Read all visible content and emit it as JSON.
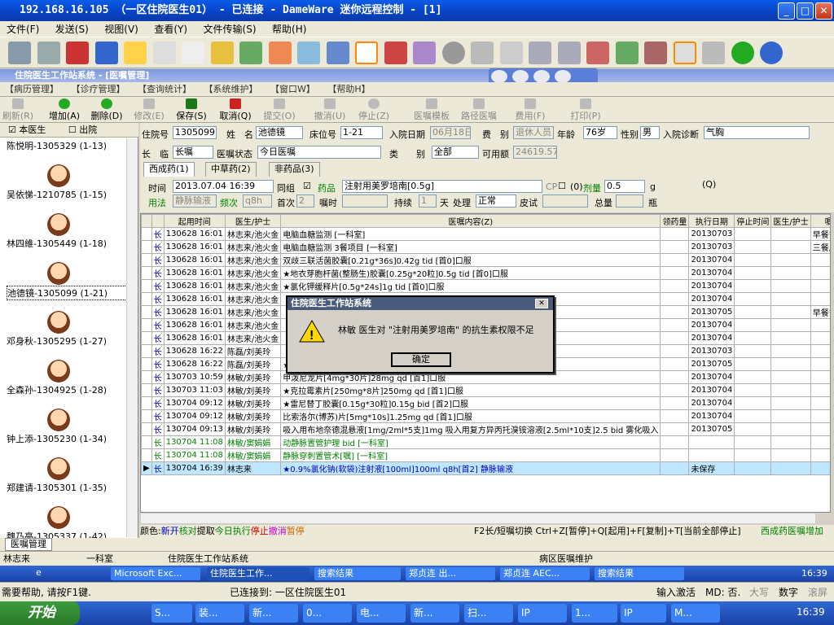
{
  "window": {
    "title": "192.168.16.105 （一区住院医生01） - 已连接 - DameWare 迷你远程控制 - [1]"
  },
  "remote_menu": [
    "文件(F)",
    "发送(S)",
    "视图(V)",
    "查看(Y)",
    "文件传输(S)",
    "帮助(H)"
  ],
  "app": {
    "title": "住院医生工作站系统 - [医嘱管理]",
    "menu": [
      "【病历管理】",
      "【诊疗管理】",
      "【查询统计】",
      "【系统维护】",
      "【窗口W】",
      "【帮助H】"
    ],
    "toolbar": [
      {
        "label": "刷新(R)",
        "enabled": false
      },
      {
        "label": "增加(A)",
        "enabled": true
      },
      {
        "label": "删除(D)",
        "enabled": true
      },
      {
        "label": "修改(E)",
        "enabled": false
      },
      {
        "label": "保存(S)",
        "enabled": true
      },
      {
        "label": "取消(Q)",
        "enabled": true
      },
      {
        "label": "提交(O)",
        "enabled": false
      },
      {
        "label": "撤消(U)",
        "enabled": false
      },
      {
        "label": "停止(Z)",
        "enabled": false
      },
      {
        "label": "医嘱模板",
        "enabled": false
      },
      {
        "label": "路径医嘱",
        "enabled": false
      },
      {
        "label": "费用(F)",
        "enabled": false
      },
      {
        "label": "打印(P)",
        "enabled": false
      }
    ]
  },
  "patients_panel": {
    "this_doctor_label": "本医生",
    "discharged_label": "出院",
    "patients": [
      "陈悦明-1305329 (1-13)",
      "吴依悌-1210785 (1-15)",
      "林四維-1305449 (1-18)",
      "池德镜-1305099 (1-21)",
      "邓身秋-1305295 (1-27)",
      "全森孙-1304925 (1-28)",
      "钟上添-1305230 (1-34)",
      "郑建请-1305301 (1-35)",
      "魏乃亮-1305337 (1-42)"
    ]
  },
  "form": {
    "admission_no_label": "住院号",
    "admission_no": "1305099",
    "name_label": "姓　名",
    "name": "池德镜",
    "bed_label": "床位号",
    "bed": "1-21",
    "admit_date_label": "入院日期",
    "admit_date": "06月18日",
    "fee_label": "费　别",
    "fee": "退休人员",
    "age_label": "年龄",
    "age": "76岁",
    "sex_label": "性别",
    "sex": "男",
    "diag_label": "入院诊断",
    "diag": "气胸",
    "order_type_label": "长　临",
    "order_type": "长嘱",
    "status_label": "医嘱状态",
    "status": "今日医嘱",
    "category_label": "类　　别",
    "category": "全部",
    "balance_label": "可用额",
    "balance": "24619.57",
    "tabs": [
      "西成药(1)",
      "中草药(2)",
      "非药品(3)"
    ],
    "time_label": "时间",
    "time": "2013.07.04 16:39",
    "group_label": "同组",
    "drug_label": "药品",
    "drug": "注射用美罗培南[0.5g]",
    "cp_label": "CP",
    "o_label": "(0)",
    "dose_label": "剂量",
    "dose": "0.5",
    "dose_unit": "g",
    "q_label": "(Q)",
    "usage_label": "用法",
    "usage": "静脉输液",
    "freq_label": "频次",
    "freq": "q8h",
    "first_label": "首次",
    "first": "2",
    "sleep_label": "嘱时",
    "duration_label": "持续",
    "duration": "1",
    "days_label": "天",
    "process_label": "处理",
    "process": "正常",
    "skin_label": "皮试",
    "total_label": "总量",
    "total_unit": "瓶"
  },
  "grid": {
    "headers": [
      "",
      "起用时间",
      "医生/护士",
      "医嘱内容(Z)",
      "领药量",
      "执行日期",
      "停止时间",
      "医生/护士",
      "嘱咐"
    ],
    "rows": [
      [
        "长",
        "130628 16:01",
        "林志来/池火金",
        "电脑血糖监测 [一科室]",
        "",
        "20130703",
        "",
        "",
        "早餐前"
      ],
      [
        "长",
        "130628 16:01",
        "林志来/池火金",
        "电脑血糖监测 3餐项目 [一科室]",
        "",
        "20130703",
        "",
        "",
        "三餐后2h"
      ],
      [
        "长",
        "130628 16:01",
        "林志来/池火金",
        "双歧三联活菌胶囊[0.21g*36s]0.42g tid [首0]口服",
        "",
        "20130704",
        "",
        "",
        ""
      ],
      [
        "长",
        "130628 16:01",
        "林志来/池火金",
        "★地衣芽胞杆菌(整肠生)胶囊[0.25g*20粒]0.5g tid [首0]口服",
        "",
        "20130704",
        "",
        "",
        ""
      ],
      [
        "长",
        "130628 16:01",
        "林志来/池火金",
        "★氯化钾缓释片[0.5g*24s]1g tid [首0]口服",
        "",
        "20130704",
        "",
        "",
        ""
      ],
      [
        "长",
        "130628 16:01",
        "林志来/池火金",
        "",
        "",
        "20130704",
        "",
        "",
        ""
      ],
      [
        "长",
        "130628 16:01",
        "林志来/池火金",
        "",
        "",
        "20130705",
        "",
        "",
        "早餐前半小"
      ],
      [
        "长",
        "130628 16:01",
        "林志来/池火金",
        "",
        "",
        "20130704",
        "",
        "",
        ""
      ],
      [
        "长",
        "130628 16:01",
        "林志来/池火金",
        "",
        "",
        "20130704",
        "",
        "",
        ""
      ],
      [
        "长",
        "130628 16:22",
        "陈磊/刘美玲",
        "",
        "",
        "20130703",
        "",
        "",
        ""
      ],
      [
        "长",
        "130628 16:22",
        "陈磊/刘美玲",
        "★氨溴索注射液[2ml:15mg*5支]45mg 注射",
        "",
        "20130705",
        "",
        "",
        ""
      ],
      [
        "长",
        "130703 10:59",
        "林敏/刘美玲",
        "甲泼尼龙片[4mg*30片]28mg qd [首1]口服",
        "",
        "20130704",
        "",
        "",
        ""
      ],
      [
        "长",
        "130703 11:03",
        "林敏/刘美玲",
        "★克拉霉素片[250mg*8片]250mg qd [首1]口服",
        "",
        "20130704",
        "",
        "",
        ""
      ],
      [
        "长",
        "130704 09:12",
        "林敏/刘美玲",
        "★雷尼替丁胶囊[0.15g*30粒]0.15g bid [首2]口服",
        "",
        "20130704",
        "",
        "",
        ""
      ],
      [
        "长",
        "130704 09:12",
        "林敏/刘美玲",
        "比索洛尔(博苏)片[5mg*10s]1.25mg qd [首1]口服",
        "",
        "20130704",
        "",
        "",
        ""
      ],
      [
        "长",
        "130704 09:13",
        "林敏/刘美玲",
        "吸入用布地奈德混悬液[1mg/2ml*5支]1mg 吸入用复方异丙托溴铵溶液[2.5ml*10支]2.5 bid 雾化吸入",
        "",
        "20130705",
        "",
        "",
        ""
      ],
      [
        "长",
        "130704 11:08",
        "林敏/窦娟娟",
        "动静脉置管护理 bid [一科室]",
        "",
        "",
        "",
        "",
        ""
      ],
      [
        "长",
        "130704 11:08",
        "林敏/窦娟娟",
        "静脉穿刺置管术[嘱] [一科室]",
        "",
        "",
        "",
        "",
        ""
      ],
      [
        "长",
        "130704 16:39",
        "林志来",
        "★0.9%氯化钠(软袋)注射液[100ml]100ml q8h[首2] 静脉输液",
        "",
        "未保存",
        "",
        "",
        ""
      ]
    ]
  },
  "legend": {
    "prefix": "颜色:",
    "new": "新开",
    "checked": "核对",
    "pick": "提取",
    "today": "今日执行",
    "stop": "停止",
    "revoke": "撤消",
    "pause": "暂停",
    "shortcuts": "F2长/短嘱切换 Ctrl+Z[暂停]+Q[起用]+F[复制]+T[当前全部停止]",
    "tail": "西成药医嘱增加"
  },
  "dialog": {
    "title": "住院医生工作站系统",
    "message": "林敏 医生对 \"注射用美罗培南\" 的抗生素权限不足",
    "ok": "确定"
  },
  "doc_tab": "医嘱管理",
  "status1": {
    "user": "林志来",
    "dept": "一科室",
    "system": "住院医生工作站系统",
    "module": "病区医嘱维护"
  },
  "remote_taskbar": {
    "items": [
      "Microsoft Exc...",
      "住院医生工作...",
      "搜索结果",
      "郑贞连 出...",
      "郑贞连 AEC...",
      "搜索结果"
    ],
    "clock": "16:39"
  },
  "status2": {
    "help": "需要帮助, 请按F1键.",
    "connected": "已连接到: 一区住院医生01",
    "input": "输入激活",
    "md": "MD: 否.",
    "caps": "大写",
    "num": "数字",
    "scroll": "滚屏"
  },
  "local_taskbar": {
    "start": "开始",
    "items": [
      "S...",
      "装...",
      "新...",
      "0...",
      "电...",
      "新...",
      "扫...",
      "IP",
      "1...",
      "IP",
      "M..."
    ],
    "clock": "16:39"
  }
}
